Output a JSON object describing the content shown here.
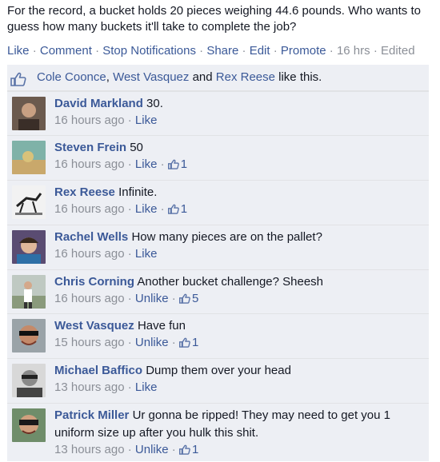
{
  "post": {
    "text": "For the record, a bucket holds 20 pieces weighing 44.6 pounds. Who wants to guess how many buckets it'll take to complete the job?",
    "actions": {
      "like": "Like",
      "comment": "Comment",
      "stop_notifications": "Stop Notifications",
      "share": "Share",
      "edit": "Edit",
      "promote": "Promote",
      "time": "16 hrs",
      "edited": "Edited",
      "separator": "·"
    }
  },
  "likes": {
    "names": [
      "Cole Coonce",
      "West Vasquez",
      "Rex Reese"
    ],
    "comma": ",",
    "and": "and",
    "suffix": "like this."
  },
  "comments": [
    {
      "author": "David Markland",
      "text": "30.",
      "time": "16 hours ago",
      "action": "Like",
      "likes": ""
    },
    {
      "author": "Steven Frein",
      "text": "50",
      "time": "16 hours ago",
      "action": "Like",
      "likes": "1"
    },
    {
      "author": "Rex Reese",
      "text": "Infinite.",
      "time": "16 hours ago",
      "action": "Like",
      "likes": "1"
    },
    {
      "author": "Rachel Wells",
      "text": "How many pieces are on the pallet?",
      "time": "16 hours ago",
      "action": "Like",
      "likes": ""
    },
    {
      "author": "Chris Corning",
      "text": "Another bucket challenge? Sheesh",
      "time": "16 hours ago",
      "action": "Unlike",
      "likes": "5"
    },
    {
      "author": "West Vasquez",
      "text": "Have fun",
      "time": "15 hours ago",
      "action": "Unlike",
      "likes": "1"
    },
    {
      "author": "Michael Baffico",
      "text": "Dump them over your head",
      "time": "13 hours ago",
      "action": "Like",
      "likes": ""
    },
    {
      "author": "Patrick Miller",
      "text": "Ur gonna be ripped! They may need to get you 1 uniform size up after you hulk this shit.",
      "time": "13 hours ago",
      "action": "Unlike",
      "likes": "1"
    }
  ],
  "colors": {
    "link": "#3b5998",
    "meta": "#8b8f97",
    "panel": "#edeff4"
  },
  "icons": {
    "like": "thumbs-up-icon"
  }
}
